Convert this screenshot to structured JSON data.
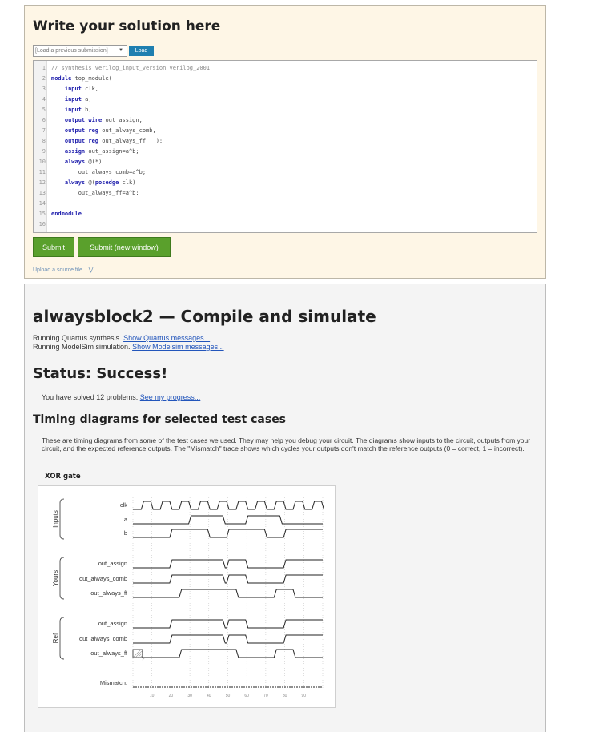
{
  "editor": {
    "heading": "Write your solution here",
    "load_select_value": "[Load a previous submission]",
    "load_button": "Load",
    "submit_button": "Submit",
    "submit_new_window_button": "Submit (new window)",
    "upload_link": "Upload a source file...",
    "code_lines": [
      {
        "n": "1",
        "text": "// synthesis verilog_input_version verilog_2001"
      },
      {
        "n": "2",
        "text": "module top_module("
      },
      {
        "n": "3",
        "text": "    input clk,"
      },
      {
        "n": "4",
        "text": "    input a,"
      },
      {
        "n": "5",
        "text": "    input b,"
      },
      {
        "n": "6",
        "text": "    output wire out_assign,"
      },
      {
        "n": "7",
        "text": "    output reg out_always_comb,"
      },
      {
        "n": "8",
        "text": "    output reg out_always_ff   );"
      },
      {
        "n": "9",
        "text": "    assign out_assign=a^b;"
      },
      {
        "n": "10",
        "text": "    always @(*)"
      },
      {
        "n": "11",
        "text": "        out_always_comb=a^b;"
      },
      {
        "n": "12",
        "text": "    always @(posedge clk)"
      },
      {
        "n": "13",
        "text": "        out_always_ff=a^b;"
      },
      {
        "n": "14",
        "text": ""
      },
      {
        "n": "15",
        "text": "endmodule"
      },
      {
        "n": "16",
        "text": ""
      }
    ]
  },
  "result": {
    "title": "alwaysblock2 — Compile and simulate",
    "quartus_text": "Running Quartus synthesis. ",
    "quartus_link": "Show Quartus messages...",
    "modelsim_text": "Running ModelSim simulation. ",
    "modelsim_link": "Show Modelsim messages...",
    "status": "Status: Success!",
    "solved_text": "You have solved 12 problems. ",
    "progress_link": "See my progress...",
    "timing_heading": "Timing diagrams for selected test cases",
    "timing_description": "These are timing diagrams from some of the test cases we used. They may help you debug your circuit. The diagrams show inputs to the circuit, outputs from your circuit, and the expected reference outputs. The \"Mismatch\" trace shows which cycles your outputs don't match the reference outputs (0 = correct, 1 = incorrect).",
    "diagram_title": "XOR gate"
  },
  "waveform": {
    "groups": [
      "Inputs",
      "Yours",
      "Ref"
    ],
    "signals": [
      "clk",
      "a",
      "b",
      "out_assign",
      "out_always_comb",
      "out_always_ff",
      "out_assign",
      "out_always_comb",
      "out_always_ff",
      "Mismatch:"
    ],
    "time_ticks": [
      "10",
      "20",
      "30",
      "40",
      "50",
      "60",
      "70",
      "80",
      "90"
    ],
    "clk_period": 10,
    "time_range": [
      0,
      100
    ],
    "a_edges": [
      [
        0,
        0
      ],
      [
        30,
        1
      ],
      [
        48,
        0
      ],
      [
        60,
        1
      ],
      [
        78,
        0
      ],
      [
        100,
        0
      ]
    ],
    "b_edges": [
      [
        0,
        0
      ],
      [
        20,
        1
      ],
      [
        40,
        0
      ],
      [
        50,
        1
      ],
      [
        70,
        0
      ],
      [
        80,
        1
      ],
      [
        100,
        1
      ]
    ],
    "out_assign_edges": [
      [
        0,
        0
      ],
      [
        20,
        1
      ],
      [
        48,
        0
      ],
      [
        50,
        1
      ],
      [
        60,
        0
      ],
      [
        80,
        1
      ],
      [
        100,
        1
      ]
    ],
    "out_always_ff_edges": [
      [
        0,
        0
      ],
      [
        25,
        1
      ],
      [
        55,
        0
      ],
      [
        65,
        0
      ],
      [
        75,
        1
      ],
      [
        85,
        0
      ],
      [
        100,
        0
      ]
    ],
    "ref_ff_unknown_until": 5,
    "colors": {
      "wave": "#222222",
      "grid": "#bbbbbb",
      "unknown_fill": "#999999"
    }
  }
}
